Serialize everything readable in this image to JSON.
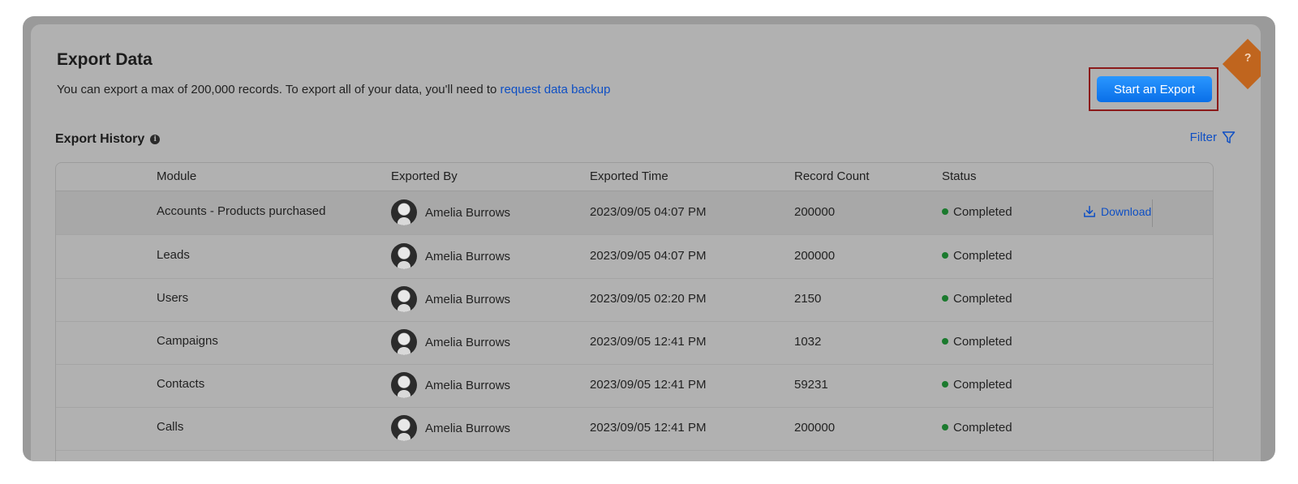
{
  "header": {
    "title": "Export Data",
    "subtitle_text": "You can export a max of 200,000 records. To export all of your data, you'll need to ",
    "subtitle_link": "request data backup",
    "export_button": "Start an Export",
    "help_label": "?"
  },
  "history": {
    "title": "Export History",
    "info_label": "i",
    "filter_label": "Filter",
    "download_label": "Download",
    "columns": {
      "module": "Module",
      "exported_by": "Exported By",
      "exported_time": "Exported Time",
      "record_count": "Record Count",
      "status": "Status"
    },
    "rows": [
      {
        "module": "Accounts - Products purchased",
        "exported_by": "Amelia Burrows",
        "exported_time": "2023/09/05 04:07 PM",
        "record_count": "200000",
        "status": "Completed"
      },
      {
        "module": "Leads",
        "exported_by": "Amelia Burrows",
        "exported_time": "2023/09/05 04:07 PM",
        "record_count": "200000",
        "status": "Completed"
      },
      {
        "module": "Users",
        "exported_by": "Amelia Burrows",
        "exported_time": "2023/09/05 02:20 PM",
        "record_count": "2150",
        "status": "Completed"
      },
      {
        "module": "Campaigns",
        "exported_by": "Amelia Burrows",
        "exported_time": "2023/09/05 12:41 PM",
        "record_count": "1032",
        "status": "Completed"
      },
      {
        "module": "Contacts",
        "exported_by": "Amelia Burrows",
        "exported_time": "2023/09/05 12:41 PM",
        "record_count": "59231",
        "status": "Completed"
      },
      {
        "module": "Calls",
        "exported_by": "Amelia Burrows",
        "exported_time": "2023/09/05 12:41 PM",
        "record_count": "200000",
        "status": "Completed"
      }
    ]
  },
  "colors": {
    "accent": "#0e4fc4",
    "button": "#0a6fe8",
    "status_completed": "#1b7a2e",
    "highlight_border": "#8b1a1a"
  }
}
